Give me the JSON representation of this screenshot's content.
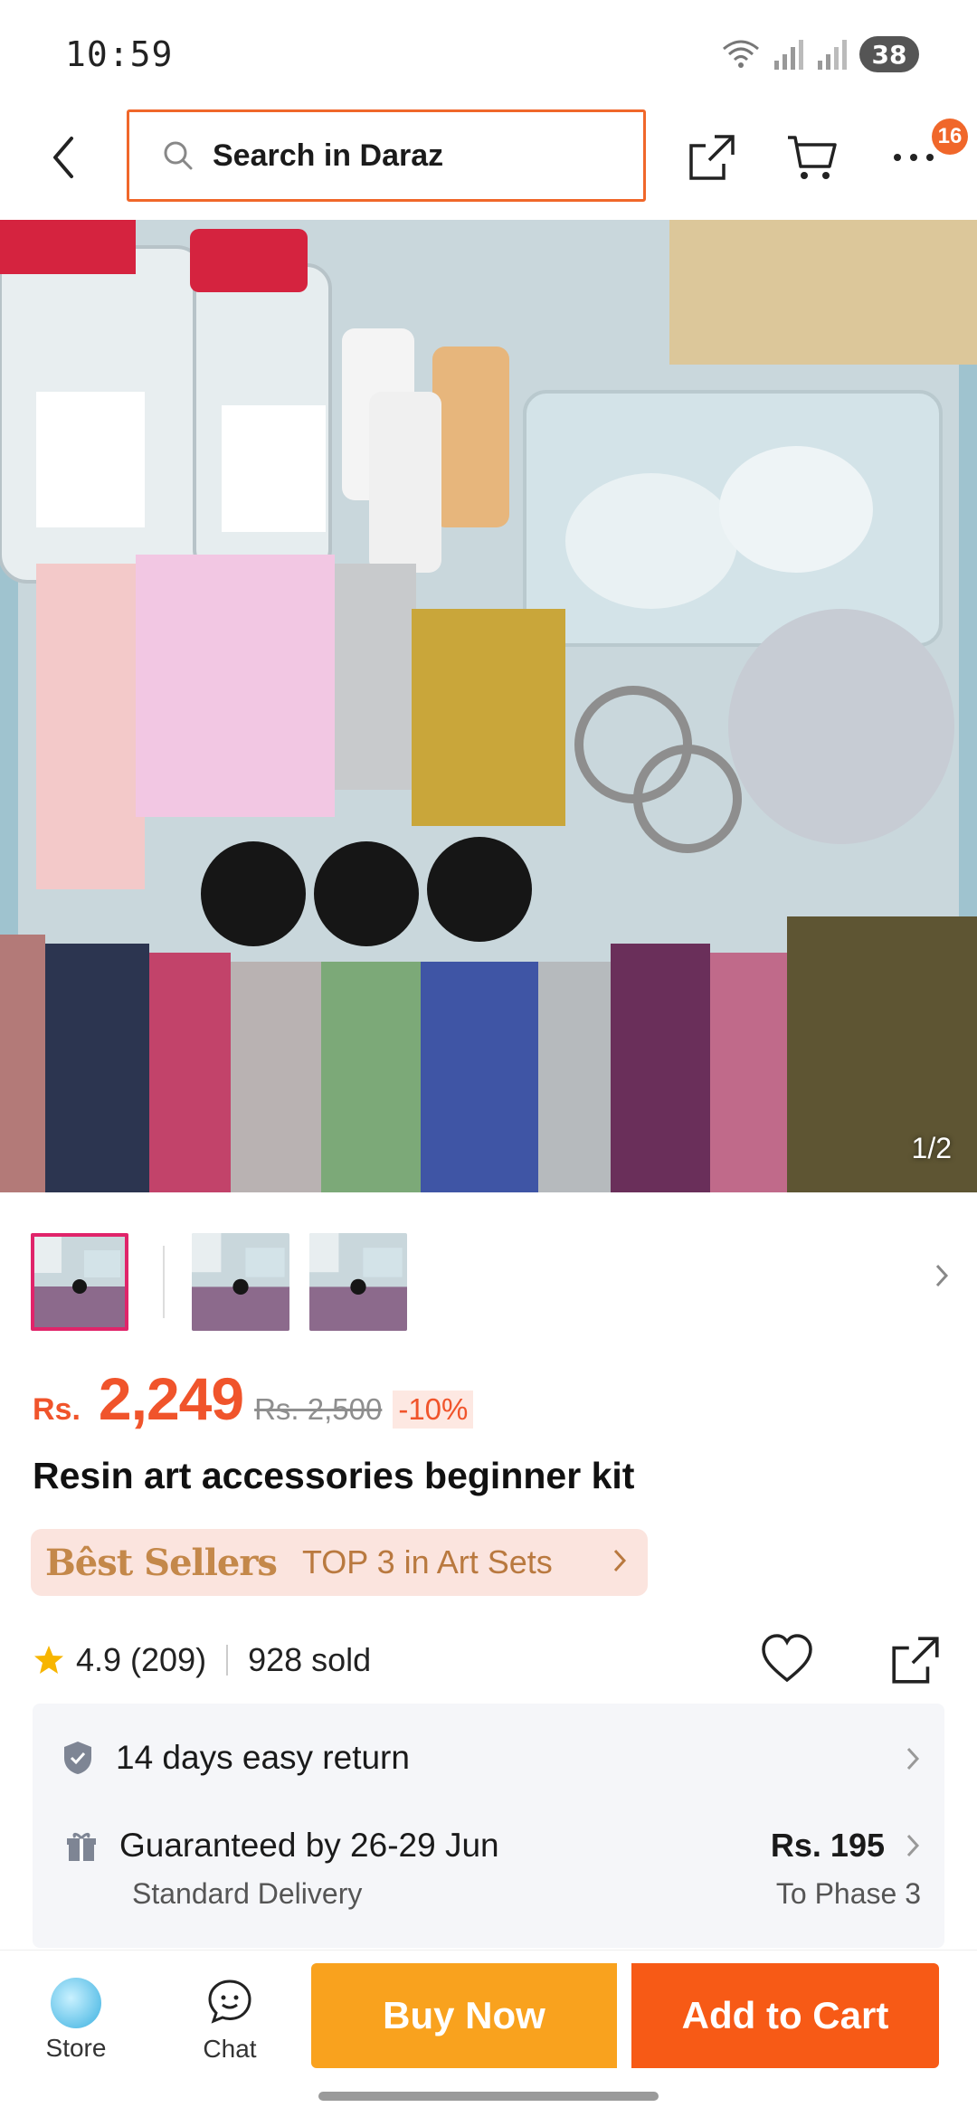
{
  "status_bar": {
    "time": "10:59",
    "battery": "38"
  },
  "header": {
    "search_placeholder": "Search in Daraz",
    "cart_badge": "16"
  },
  "gallery": {
    "counter": "1/2"
  },
  "product": {
    "currency": "Rs.",
    "price": "2,249",
    "original_price": "Rs. 2,500",
    "discount": "-10%",
    "title": "Resin art accessories beginner kit",
    "best_seller_label": "Bêst Sellers",
    "best_seller_rank": "TOP 3 in Art Sets",
    "rating": "4.9 (209)",
    "sold": "928 sold"
  },
  "services": {
    "return_policy": "14 days easy return",
    "delivery_guarantee": "Guaranteed by 26-29 Jun",
    "delivery_type": "Standard Delivery",
    "delivery_fee": "Rs. 195",
    "delivery_destination": "To Phase 3"
  },
  "bottom_bar": {
    "store_label": "Store",
    "chat_label": "Chat",
    "buy_now_label": "Buy Now",
    "add_to_cart_label": "Add to Cart"
  },
  "colors": {
    "accent": "#f0542b",
    "buy_now": "#f9a21e",
    "add_to_cart": "#f75a16"
  },
  "icons": [
    "back-arrow-icon",
    "search-icon",
    "share-icon",
    "cart-icon",
    "more-icon",
    "star-icon",
    "heart-icon",
    "shield-icon",
    "delivery-icon",
    "chat-icon",
    "store-icon"
  ]
}
